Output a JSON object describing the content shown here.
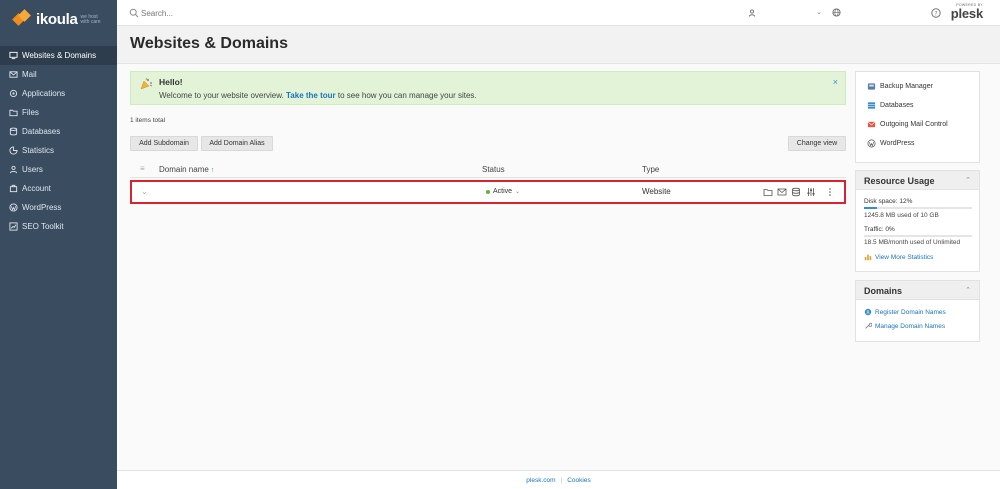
{
  "brand": {
    "name": "ikoula",
    "tagline_1": "we host",
    "tagline_2": "with care",
    "powered_by": "POWERED BY",
    "product": "plesk"
  },
  "sidebar": {
    "items": [
      {
        "label": "Websites & Domains",
        "icon": "monitor-icon",
        "active": true
      },
      {
        "label": "Mail",
        "icon": "mail-icon"
      },
      {
        "label": "Applications",
        "icon": "applications-icon"
      },
      {
        "label": "Files",
        "icon": "folder-icon"
      },
      {
        "label": "Databases",
        "icon": "database-icon"
      },
      {
        "label": "Statistics",
        "icon": "statistics-icon"
      },
      {
        "label": "Users",
        "icon": "user-icon"
      },
      {
        "label": "Account",
        "icon": "account-icon"
      },
      {
        "label": "WordPress",
        "icon": "wordpress-icon"
      },
      {
        "label": "SEO Toolkit",
        "icon": "seo-icon"
      }
    ]
  },
  "topbar": {
    "search_placeholder": "Search..."
  },
  "page": {
    "title": "Websites & Domains"
  },
  "hello": {
    "title": "Hello!",
    "text_before": "Welcome to your website overview. ",
    "link": "Take the tour",
    "text_after": " to see how you can manage your sites.",
    "close": "×"
  },
  "list": {
    "items_total": "1 items total",
    "add_subdomain": "Add Subdomain",
    "add_alias": "Add Domain Alias",
    "change_view": "Change view",
    "columns": {
      "name": "Domain name",
      "sort_arrow": "↑",
      "status": "Status",
      "type": "Type"
    },
    "rows": [
      {
        "name": "",
        "status": "Active",
        "type": "Website"
      }
    ]
  },
  "quick_links": [
    {
      "label": "Backup Manager",
      "icon": "backup-icon"
    },
    {
      "label": "Databases",
      "icon": "database-icon"
    },
    {
      "label": "Outgoing Mail Control",
      "icon": "mail-control-icon"
    },
    {
      "label": "WordPress",
      "icon": "wordpress-icon"
    }
  ],
  "resource_usage": {
    "title": "Resource Usage",
    "disk_label": "Disk space:",
    "disk_pct": "12%",
    "disk_fraction": 0.12,
    "disk_detail": "1245.8 MB used of 10 GB",
    "traffic_label": "Traffic:",
    "traffic_pct": "0%",
    "traffic_fraction": 0,
    "traffic_detail": "18.5 MB/month used of Unlimited",
    "more_link": "View More Statistics"
  },
  "domains_panel": {
    "title": "Domains",
    "register": "Register Domain Names",
    "manage": "Manage Domain Names"
  },
  "footer": {
    "link1": "plesk.com",
    "link2": "Cookies"
  },
  "colors": {
    "sidebar_bg": "#3a4d60",
    "accent": "#1b74b8",
    "highlight": "#d9232e",
    "active_status": "#5fb336"
  }
}
